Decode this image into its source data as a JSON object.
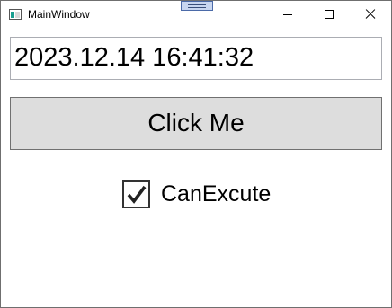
{
  "window": {
    "title": "MainWindow",
    "icon": "app-window-icon",
    "controls": [
      "minimize-icon",
      "maximize-icon",
      "close-icon"
    ]
  },
  "main": {
    "datetime_text": "2023.12.14 16:41:32",
    "button_label": "Click Me",
    "checkbox": {
      "label": "CanExcute",
      "checked": true
    }
  },
  "colors": {
    "button_bg": "#dddddd",
    "textbox_border": "#abadb3",
    "check_stroke": "#333333"
  }
}
